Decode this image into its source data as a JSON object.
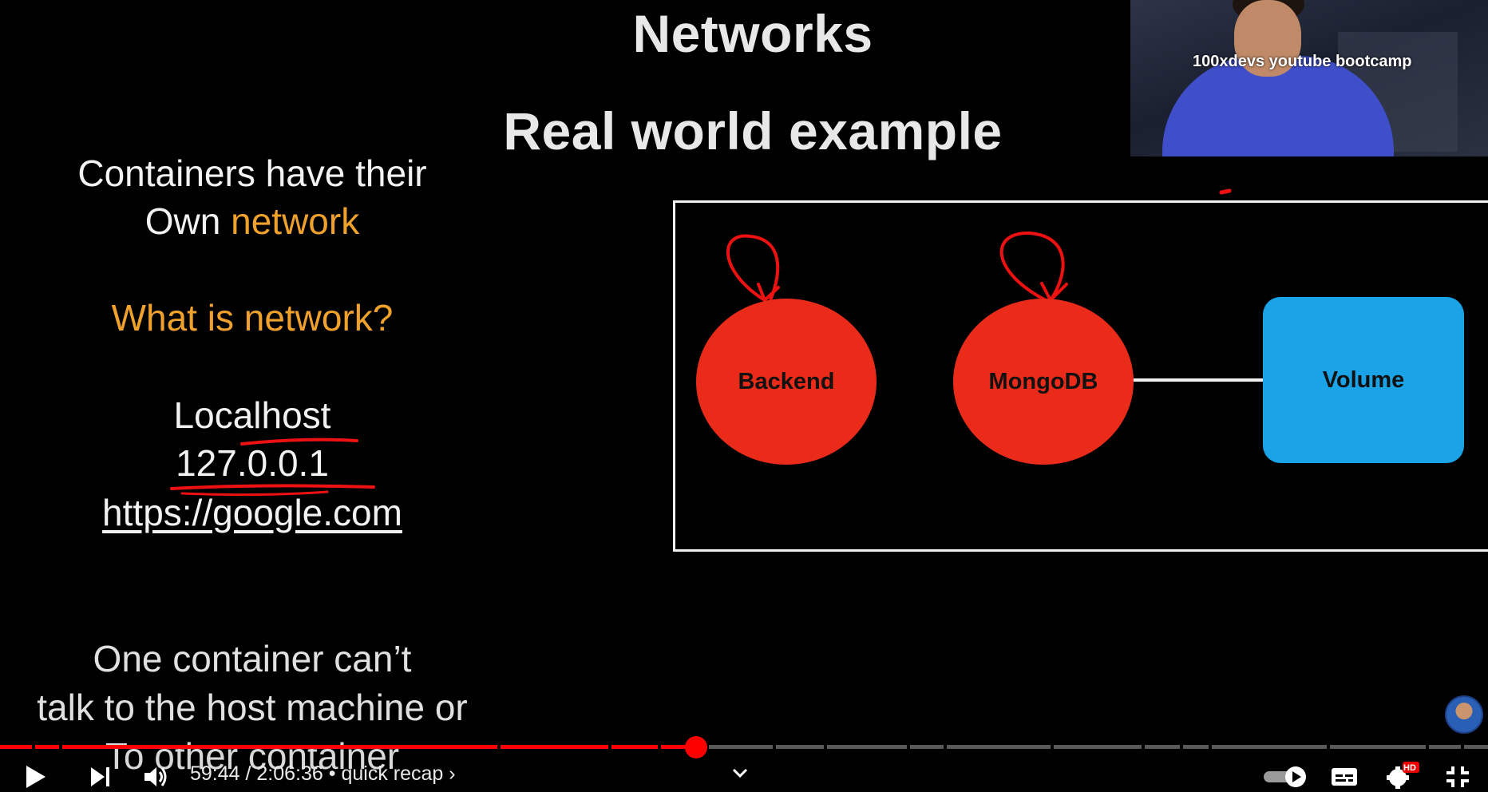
{
  "slide": {
    "title": "Networks",
    "subtitle": "Real world example",
    "left_lines": {
      "l1": "Containers have their",
      "l2_prefix": "Own ",
      "l2_highlight": "network",
      "q": "What is network?",
      "localhost": "Localhost",
      "ip": "127.0.0.1",
      "url": "https://google.com",
      "bottom1": "One container can’t",
      "bottom2": "talk to the host machine or",
      "bottom3": "To other container"
    },
    "diagram": {
      "nodes": [
        {
          "label": "Backend",
          "color": "#ea2b1a"
        },
        {
          "label": "MongoDB",
          "color": "#ea2b1a"
        },
        {
          "label": "Volume",
          "color": "#1aa3e6"
        }
      ]
    }
  },
  "webcam": {
    "caption": "100xdevs  youtube bootcamp"
  },
  "player": {
    "progress_fraction": 0.4722,
    "time": "59:44 / 2:06:36",
    "chapter": "• quick recap ›",
    "hd_badge": "HD",
    "accent": "#ff0000",
    "icons": [
      "play-icon",
      "next-icon",
      "volume-icon",
      "chevron-down-icon",
      "autoplay-toggle-icon",
      "captions-icon",
      "settings-icon",
      "exit-fullscreen-icon"
    ]
  }
}
